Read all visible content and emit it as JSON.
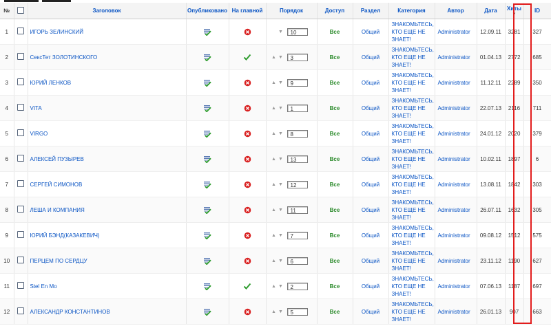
{
  "headers": {
    "num": "№",
    "title": "Заголовок",
    "published": "Опубликовано",
    "featured": "На главной",
    "order": "Порядок",
    "access": "Доступ",
    "section": "Раздел",
    "category": "Категория",
    "author": "Автор",
    "date": "Дата",
    "hits": "Хиты",
    "id": "ID"
  },
  "sort": {
    "column": "hits",
    "direction": "descending",
    "indicator": "▼"
  },
  "highlight_color": "#e21c1c",
  "rows": [
    {
      "num": "1",
      "title": "ИГОРЬ ЗЕЛИНСКИЙ",
      "featured": false,
      "up": false,
      "down": true,
      "order": "10",
      "access": "Все",
      "section": "Общий",
      "category": [
        "ЗНАКОМЬТЕСЬ,",
        "КТО ЕЩЕ НЕ",
        "ЗНАЕТ!"
      ],
      "author": "Administrator",
      "date": "12.09.11",
      "hits": "3281",
      "id": "327"
    },
    {
      "num": "2",
      "title": "СексТет ЗОЛОТИНСКОГО",
      "featured": true,
      "up": true,
      "down": true,
      "order": "3",
      "access": "Все",
      "section": "Общий",
      "category": [
        "ЗНАКОМЬТЕСЬ,",
        "КТО ЕЩЕ НЕ",
        "ЗНАЕТ!"
      ],
      "author": "Administrator",
      "date": "01.04.13",
      "hits": "2772",
      "id": "685"
    },
    {
      "num": "3",
      "title": "ЮРИЙ ЛЕНКОВ",
      "featured": false,
      "up": true,
      "down": true,
      "order": "9",
      "access": "Все",
      "section": "Общий",
      "category": [
        "ЗНАКОМЬТЕСЬ,",
        "КТО ЕЩЕ НЕ",
        "ЗНАЕТ!"
      ],
      "author": "Administrator",
      "date": "11.12.11",
      "hits": "2289",
      "id": "350"
    },
    {
      "num": "4",
      "title": "VITA",
      "featured": false,
      "up": true,
      "down": true,
      "order": "1",
      "access": "Все",
      "section": "Общий",
      "category": [
        "ЗНАКОМЬТЕСЬ,",
        "КТО ЕЩЕ НЕ",
        "ЗНАЕТ!"
      ],
      "author": "Administrator",
      "date": "22.07.13",
      "hits": "2116",
      "id": "711"
    },
    {
      "num": "5",
      "title": "VIRGO",
      "featured": false,
      "up": true,
      "down": true,
      "order": "8",
      "access": "Все",
      "section": "Общий",
      "category": [
        "ЗНАКОМЬТЕСЬ,",
        "КТО ЕЩЕ НЕ",
        "ЗНАЕТ!"
      ],
      "author": "Administrator",
      "date": "24.01.12",
      "hits": "2020",
      "id": "379"
    },
    {
      "num": "6",
      "title": "АЛЕКСЕЙ ПУЗЫРЕВ",
      "featured": false,
      "up": true,
      "down": true,
      "order": "13",
      "access": "Все",
      "section": "Общий",
      "category": [
        "ЗНАКОМЬТЕСЬ,",
        "КТО ЕЩЕ НЕ",
        "ЗНАЕТ!"
      ],
      "author": "Administrator",
      "date": "10.02.11",
      "hits": "1897",
      "id": "6"
    },
    {
      "num": "7",
      "title": "СЕРГЕЙ СИМОНОВ",
      "featured": false,
      "up": true,
      "down": true,
      "order": "12",
      "access": "Все",
      "section": "Общий",
      "category": [
        "ЗНАКОМЬТЕСЬ,",
        "КТО ЕЩЕ НЕ",
        "ЗНАЕТ!"
      ],
      "author": "Administrator",
      "date": "13.08.11",
      "hits": "1842",
      "id": "303"
    },
    {
      "num": "8",
      "title": "ЛЕША И КОМПАНИЯ",
      "featured": false,
      "up": true,
      "down": true,
      "order": "11",
      "access": "Все",
      "section": "Общий",
      "category": [
        "ЗНАКОМЬТЕСЬ,",
        "КТО ЕЩЕ НЕ",
        "ЗНАЕТ!"
      ],
      "author": "Administrator",
      "date": "26.07.11",
      "hits": "1632",
      "id": "305"
    },
    {
      "num": "9",
      "title": "ЮРИЙ БЭНД(КАЗАКЕВИЧ)",
      "featured": false,
      "up": true,
      "down": true,
      "order": "7",
      "access": "Все",
      "section": "Общий",
      "category": [
        "ЗНАКОМЬТЕСЬ,",
        "КТО ЕЩЕ НЕ",
        "ЗНАЕТ!"
      ],
      "author": "Administrator",
      "date": "09.08.12",
      "hits": "1512",
      "id": "575"
    },
    {
      "num": "10",
      "title": "ПЕРЦЕМ ПО СЕРДЦУ",
      "featured": false,
      "up": true,
      "down": true,
      "order": "6",
      "access": "Все",
      "section": "Общий",
      "category": [
        "ЗНАКОМЬТЕСЬ,",
        "КТО ЕЩЕ НЕ",
        "ЗНАЕТ!"
      ],
      "author": "Administrator",
      "date": "23.11.12",
      "hits": "1190",
      "id": "627"
    },
    {
      "num": "11",
      "title": "Stel En Mo",
      "featured": true,
      "up": true,
      "down": true,
      "order": "2",
      "access": "Все",
      "section": "Общий",
      "category": [
        "ЗНАКОМЬТЕСЬ,",
        "КТО ЕЩЕ НЕ",
        "ЗНАЕТ!"
      ],
      "author": "Administrator",
      "date": "07.06.13",
      "hits": "1187",
      "id": "697"
    },
    {
      "num": "12",
      "title": "АЛЕКСАНДР КОНСТАНТИНОВ",
      "featured": false,
      "up": true,
      "down": true,
      "order": "5",
      "access": "Все",
      "section": "Общий",
      "category": [
        "ЗНАКОМЬТЕСЬ,",
        "КТО ЕЩЕ НЕ",
        "ЗНАЕТ!"
      ],
      "author": "Administrator",
      "date": "26.01.13",
      "hits": "907",
      "id": "663"
    }
  ]
}
